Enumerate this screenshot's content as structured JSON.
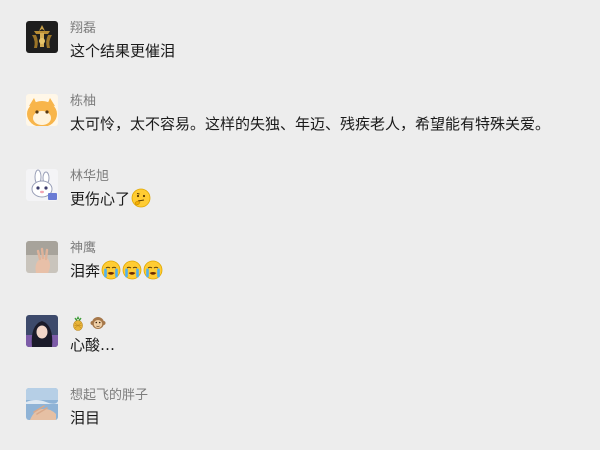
{
  "comments": [
    {
      "username": "翔磊",
      "text": "这个结果更催泪",
      "emojis": [],
      "avatar": "dark-gold-emblem-avatar"
    },
    {
      "username": "栋柚",
      "text": "太可怜，太不容易。这样的失独、年迈、残疾老人，希望能有特殊关爱。",
      "emojis": [],
      "avatar": "orange-cat-avatar"
    },
    {
      "username": "林华旭",
      "text": "更伤心了",
      "emojis": [
        "thinking-face-emoji"
      ],
      "avatar": "cartoon-rabbit-avatar"
    },
    {
      "username": "神鹰",
      "text": "泪奔",
      "emojis": [
        "loudly-crying-face-emoji",
        "loudly-crying-face-emoji",
        "loudly-crying-face-emoji"
      ],
      "avatar": "hand-photo-avatar"
    },
    {
      "username": "",
      "username_emojis": [
        "pineapple-emoji",
        "monkey-face-emoji"
      ],
      "text": "心酸…",
      "emojis": [],
      "avatar": "dark-hair-girl-avatar"
    },
    {
      "username": "想起飞的胖子",
      "text": "泪目",
      "emojis": [],
      "avatar": "sky-hand-avatar"
    }
  ],
  "colors": {
    "background": "#ededed",
    "username": "#7d7d7d",
    "text": "#1a1a1a"
  }
}
